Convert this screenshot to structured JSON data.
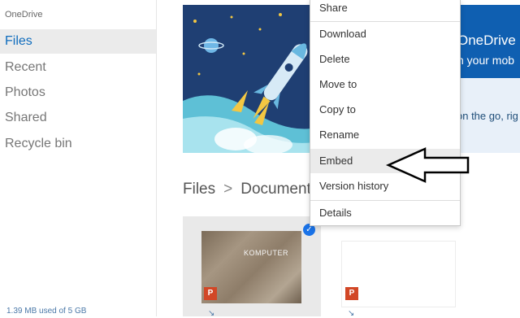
{
  "sidebar": {
    "brand": "OneDrive",
    "items": [
      {
        "label": "Files",
        "active": true
      },
      {
        "label": "Recent",
        "active": false
      },
      {
        "label": "Photos",
        "active": false
      },
      {
        "label": "Shared",
        "active": false
      },
      {
        "label": "Recycle bin",
        "active": false
      }
    ],
    "storage": "1.39 MB used of 5 GB"
  },
  "banner": {
    "line1": "OneDrive",
    "line2": "n your mob",
    "line3": "on the go, rig"
  },
  "breadcrumb": {
    "root": "Files",
    "separator": ">",
    "current": "Document"
  },
  "files": [
    {
      "thumb_title": "KOMPUTER",
      "type_icon": "P",
      "selected": true
    },
    {
      "thumb_title": "",
      "type_icon": "P",
      "selected": false
    }
  ],
  "context_menu": {
    "items": [
      "Share",
      "Download",
      "Delete",
      "Move to",
      "Copy to",
      "Rename",
      "Embed",
      "Version history",
      "Details"
    ],
    "highlighted": "Embed"
  },
  "colors": {
    "accent": "#0f6cbd",
    "banner_blue": "#0f5fb1",
    "check_blue": "#1a73e8",
    "ppt_red": "#d24726"
  }
}
